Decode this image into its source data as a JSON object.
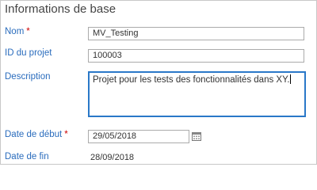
{
  "section": {
    "title": "Informations de base"
  },
  "fields": {
    "nom": {
      "label": "Nom",
      "required_mark": "*",
      "value": "MV_Testing"
    },
    "id_projet": {
      "label": "ID du projet",
      "value": "100003"
    },
    "description": {
      "label": "Description",
      "value": "Projet pour les tests des fonctionnalités dans XY."
    },
    "date_debut": {
      "label": "Date de début",
      "required_mark": "*",
      "value": "29/05/2018"
    },
    "date_fin": {
      "label": "Date de fin",
      "value": "28/09/2018"
    }
  },
  "icons": {
    "calendar": "calendar-icon"
  },
  "colors": {
    "label": "#2a6cbd",
    "required": "#cc0000",
    "focus_border": "#2a78c8"
  }
}
